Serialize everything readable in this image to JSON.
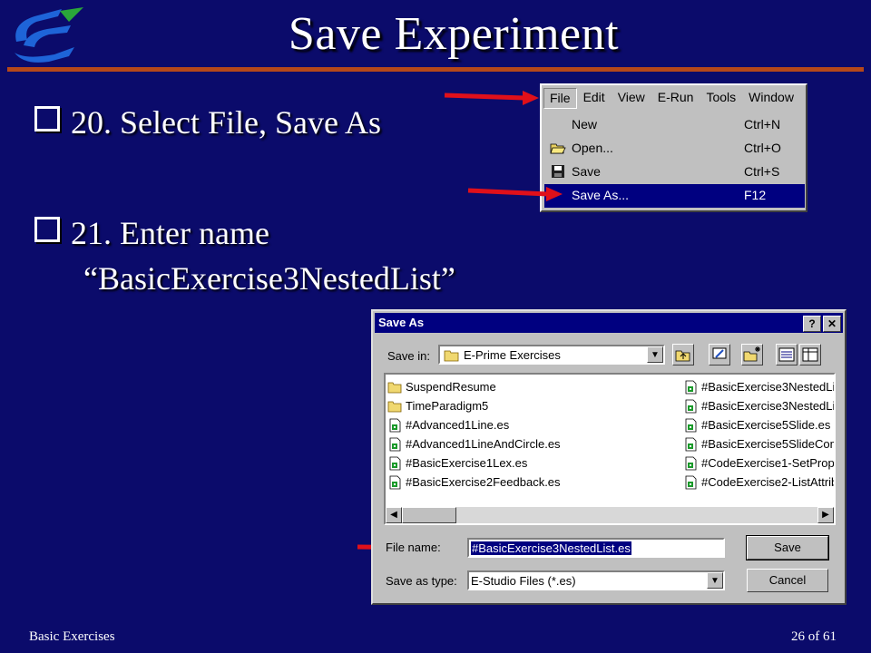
{
  "slide": {
    "title": "Save Experiment",
    "bullets": [
      {
        "text": "20. Select File, Save As"
      },
      {
        "text": "21. Enter name"
      }
    ],
    "bullet2_cont": "“BasicExercise3NestedList”",
    "footer_left": "Basic Exercises",
    "footer_right": "26 of  61",
    "colors": {
      "background": "#0b0b6b",
      "rule": "#b5481a",
      "arrow": "#e0101a",
      "selection": "#000080"
    }
  },
  "menu": {
    "bar": [
      "File",
      "Edit",
      "View",
      "E-Run",
      "Tools",
      "Window"
    ],
    "active": "File",
    "items": [
      {
        "label": "New",
        "shortcut": "Ctrl+N",
        "icon": "blank-icon"
      },
      {
        "label": "Open...",
        "shortcut": "Ctrl+O",
        "icon": "open-folder-icon"
      },
      {
        "label": "Save",
        "shortcut": "Ctrl+S",
        "icon": "floppy-disk-icon"
      },
      {
        "label": "Save As...",
        "shortcut": "F12",
        "icon": "blank-icon",
        "selected": true
      }
    ]
  },
  "dialog": {
    "title": "Save As",
    "help_btn": "?",
    "close_btn": "✕",
    "save_in_label": "Save in:",
    "save_in_value": "E-Prime Exercises",
    "files_left": [
      {
        "name": "SuspendResume",
        "type": "folder"
      },
      {
        "name": "TimeParadigm5",
        "type": "folder"
      },
      {
        "name": "#Advanced1Line.es",
        "type": "es"
      },
      {
        "name": "#Advanced1LineAndCircle.es",
        "type": "es"
      },
      {
        "name": "#BasicExercise1Lex.es",
        "type": "es"
      },
      {
        "name": "#BasicExercise2Feedback.es",
        "type": "es"
      }
    ],
    "files_right": [
      {
        "name": "#BasicExercise3NestedLi:",
        "type": "es"
      },
      {
        "name": "#BasicExercise3NestedLi:",
        "type": "es"
      },
      {
        "name": "#BasicExercise5Slide.es",
        "type": "es"
      },
      {
        "name": "#BasicExercise5SlideCom",
        "type": "es"
      },
      {
        "name": "#CodeExercise1-SetPrope",
        "type": "es"
      },
      {
        "name": "#CodeExercise2-ListAttribu",
        "type": "es"
      }
    ],
    "file_name_label": "File name:",
    "file_name_value": "#BasicExercise3NestedList.es",
    "save_type_label": "Save as type:",
    "save_type_value": "E-Studio Files (*.es)",
    "save_button": "Save",
    "cancel_button": "Cancel"
  }
}
